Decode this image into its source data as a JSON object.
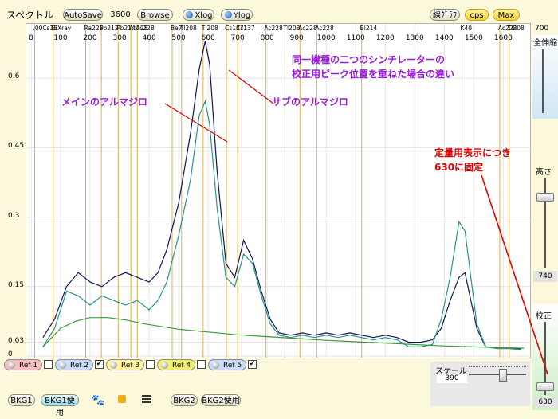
{
  "toolbar": {
    "title": "スペクトル",
    "autosave": "AutoSave",
    "time_value": "3600",
    "browse": "Browse",
    "xlog": "Xlog",
    "ylog": "Ylog",
    "line_graph": "線ｸﾞﾗﾌ",
    "cps": "cps",
    "max": "Max"
  },
  "right_panel": {
    "top_value": "700",
    "zoom_label": "全伸縮",
    "height_label": "高さ",
    "height_value": "740",
    "calib_label": "校正",
    "bottom_value": "630"
  },
  "bottom_bar": {
    "refs": [
      {
        "label": "Ref 1",
        "checked": false,
        "color": "#f7c0c0"
      },
      {
        "label": "Ref 2",
        "checked": true,
        "color": "#c8dcf8"
      },
      {
        "label": "Ref 3",
        "checked": false,
        "color": "#fff3a0"
      },
      {
        "label": "Ref 4",
        "checked": false,
        "color": "#f3f070"
      },
      {
        "label": "Ref 5",
        "checked": true,
        "color": "#c8dcf8"
      }
    ],
    "bkg1": "BKG1",
    "bkg1_use": "BKG1使用",
    "bkg2": "BKG2",
    "bkg2_use": "BKG2使用",
    "scale_label": "スケール",
    "scale_value": "390"
  },
  "annotations": {
    "title_line1": "同一機種の二つのシンチレーターの",
    "title_line2": "校正用ピーク位置を重ねた場合の違い",
    "main_label": "メインのアルマジロ",
    "sub_label": "サブのアルマジロ",
    "fixed_line1": "定量用表示につき",
    "fixed_line2": "630に固定",
    "color_purple": "#9a1bd9",
    "color_red": "#e00000"
  },
  "chart_data": {
    "type": "line",
    "title": "",
    "xlabel": "",
    "ylabel": "",
    "xlim": [
      0,
      1680
    ],
    "ylim": [
      0,
      0.7
    ],
    "x_ticks": [
      "0",
      "100",
      "200",
      "300",
      "400",
      "500",
      "600",
      "700",
      "800",
      "900",
      "1000",
      "1100",
      "1200",
      "1300",
      "1400",
      "1500",
      "1600"
    ],
    "y_ticks": [
      "0",
      "0.03",
      "0.15",
      "0.3",
      "0.45",
      "0.6"
    ],
    "isotope_labels": [
      {
        "text": ".00Cs13",
        "x": 12
      },
      {
        "text": "BiXray",
        "x": 75
      },
      {
        "text": "Ra226",
        "x": 185
      },
      {
        "text": "Pb212",
        "x": 238
      },
      {
        "text": "Pb214",
        "x": 295
      },
      {
        "text": "Ac228",
        "x": 338
      },
      {
        "text": "Ac228",
        "x": 360
      },
      {
        "text": "Be7",
        "x": 478
      },
      {
        "text": "Tl208",
        "x": 510
      },
      {
        "text": "Tl208",
        "x": 583
      },
      {
        "text": "Cs137",
        "x": 662
      },
      {
        "text": "Cs137",
        "x": 700
      },
      {
        "text": "Ac228",
        "x": 795
      },
      {
        "text": "Tl208",
        "x": 860
      },
      {
        "text": "Ac228",
        "x": 911
      },
      {
        "text": "Ac228",
        "x": 968
      },
      {
        "text": "Bi214",
        "x": 1120
      },
      {
        "text": "K40",
        "x": 1460
      },
      {
        "text": "Ac228",
        "x": 1588
      },
      {
        "text": "Tl208",
        "x": 1620
      }
    ],
    "series": [
      {
        "color": "#0f1458",
        "points": [
          [
            40,
            0.04
          ],
          [
            80,
            0.08
          ],
          [
            120,
            0.15
          ],
          [
            160,
            0.18
          ],
          [
            200,
            0.16
          ],
          [
            240,
            0.15
          ],
          [
            280,
            0.17
          ],
          [
            320,
            0.18
          ],
          [
            360,
            0.17
          ],
          [
            400,
            0.16
          ],
          [
            430,
            0.18
          ],
          [
            460,
            0.23
          ],
          [
            500,
            0.33
          ],
          [
            540,
            0.48
          ],
          [
            570,
            0.62
          ],
          [
            590,
            0.68
          ],
          [
            605,
            0.63
          ],
          [
            630,
            0.4
          ],
          [
            660,
            0.2
          ],
          [
            690,
            0.17
          ],
          [
            720,
            0.25
          ],
          [
            750,
            0.21
          ],
          [
            780,
            0.14
          ],
          [
            810,
            0.08
          ],
          [
            840,
            0.05
          ],
          [
            880,
            0.045
          ],
          [
            920,
            0.05
          ],
          [
            960,
            0.045
          ],
          [
            1000,
            0.05
          ],
          [
            1040,
            0.045
          ],
          [
            1080,
            0.05
          ],
          [
            1120,
            0.045
          ],
          [
            1160,
            0.04
          ],
          [
            1200,
            0.045
          ],
          [
            1240,
            0.04
          ],
          [
            1280,
            0.03
          ],
          [
            1320,
            0.03
          ],
          [
            1360,
            0.035
          ],
          [
            1390,
            0.06
          ],
          [
            1420,
            0.12
          ],
          [
            1450,
            0.17
          ],
          [
            1470,
            0.18
          ],
          [
            1490,
            0.12
          ],
          [
            1510,
            0.06
          ],
          [
            1540,
            0.02
          ],
          [
            1580,
            0.018
          ],
          [
            1620,
            0.018
          ],
          [
            1660,
            0.015
          ]
        ]
      },
      {
        "color": "#2a9488",
        "points": [
          [
            40,
            0.02
          ],
          [
            80,
            0.06
          ],
          [
            120,
            0.14
          ],
          [
            160,
            0.13
          ],
          [
            200,
            0.11
          ],
          [
            240,
            0.13
          ],
          [
            280,
            0.12
          ],
          [
            320,
            0.11
          ],
          [
            360,
            0.12
          ],
          [
            400,
            0.1
          ],
          [
            430,
            0.12
          ],
          [
            460,
            0.16
          ],
          [
            500,
            0.26
          ],
          [
            540,
            0.38
          ],
          [
            570,
            0.52
          ],
          [
            590,
            0.55
          ],
          [
            605,
            0.5
          ],
          [
            630,
            0.32
          ],
          [
            660,
            0.17
          ],
          [
            690,
            0.15
          ],
          [
            720,
            0.22
          ],
          [
            750,
            0.2
          ],
          [
            780,
            0.13
          ],
          [
            810,
            0.07
          ],
          [
            840,
            0.045
          ],
          [
            880,
            0.04
          ],
          [
            920,
            0.045
          ],
          [
            960,
            0.04
          ],
          [
            1000,
            0.045
          ],
          [
            1040,
            0.04
          ],
          [
            1080,
            0.045
          ],
          [
            1120,
            0.04
          ],
          [
            1160,
            0.035
          ],
          [
            1200,
            0.04
          ],
          [
            1240,
            0.035
          ],
          [
            1280,
            0.02
          ],
          [
            1320,
            0.02
          ],
          [
            1360,
            0.025
          ],
          [
            1390,
            0.08
          ],
          [
            1420,
            0.17
          ],
          [
            1450,
            0.29
          ],
          [
            1470,
            0.27
          ],
          [
            1490,
            0.17
          ],
          [
            1510,
            0.07
          ],
          [
            1540,
            0.02
          ],
          [
            1580,
            0.016
          ],
          [
            1620,
            0.016
          ],
          [
            1660,
            0.014
          ]
        ]
      },
      {
        "color": "#3a9a3a",
        "points": [
          [
            40,
            0.02
          ],
          [
            100,
            0.06
          ],
          [
            150,
            0.075
          ],
          [
            200,
            0.083
          ],
          [
            260,
            0.083
          ],
          [
            320,
            0.078
          ],
          [
            380,
            0.07
          ],
          [
            440,
            0.064
          ],
          [
            500,
            0.058
          ],
          [
            600,
            0.052
          ],
          [
            700,
            0.046
          ],
          [
            800,
            0.042
          ],
          [
            900,
            0.038
          ],
          [
            1000,
            0.034
          ],
          [
            1100,
            0.031
          ],
          [
            1200,
            0.028
          ],
          [
            1300,
            0.025
          ],
          [
            1400,
            0.022
          ],
          [
            1500,
            0.02
          ],
          [
            1600,
            0.018
          ],
          [
            1670,
            0.017
          ]
        ]
      }
    ]
  }
}
